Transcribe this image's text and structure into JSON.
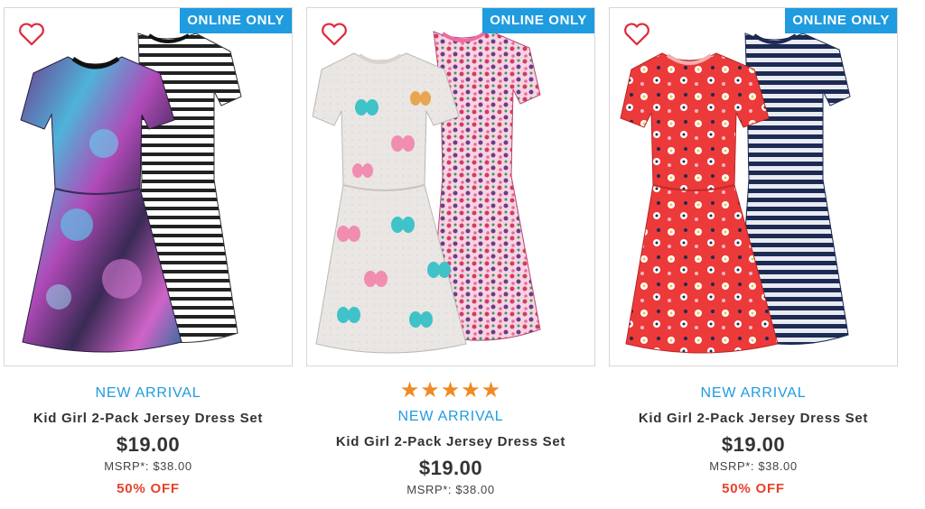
{
  "products": [
    {
      "badge": "ONLINE ONLY",
      "stars": "",
      "new_arrival": "NEW ARRIVAL",
      "title": "Kid Girl 2-Pack Jersey Dress Set",
      "price": "$19.00",
      "msrp": "MSRP*: $38.00",
      "discount": "50% OFF",
      "front_dress": "galaxy print purple/blue",
      "back_dress": "black and white stripe"
    },
    {
      "badge": "ONLINE ONLY",
      "stars": "★★★★★",
      "rating": 5,
      "new_arrival": "NEW ARRIVAL",
      "title": "Kid Girl 2-Pack Jersey Dress Set",
      "price": "$19.00",
      "msrp": "MSRP*: $38.00",
      "discount": "",
      "front_dress": "grey butterfly print",
      "back_dress": "pink floral print"
    },
    {
      "badge": "ONLINE ONLY",
      "stars": "",
      "new_arrival": "NEW ARRIVAL",
      "title": "Kid Girl 2-Pack Jersey Dress Set",
      "price": "$19.00",
      "msrp": "MSRP*: $38.00",
      "discount": "50% OFF",
      "front_dress": "red floral print",
      "back_dress": "navy stripe"
    }
  ],
  "colors": {
    "badge": "#1f9be0",
    "new_arrival": "#1f9be0",
    "discount": "#e8422a",
    "stars": "#f08a24",
    "heart": "#e0293a"
  }
}
